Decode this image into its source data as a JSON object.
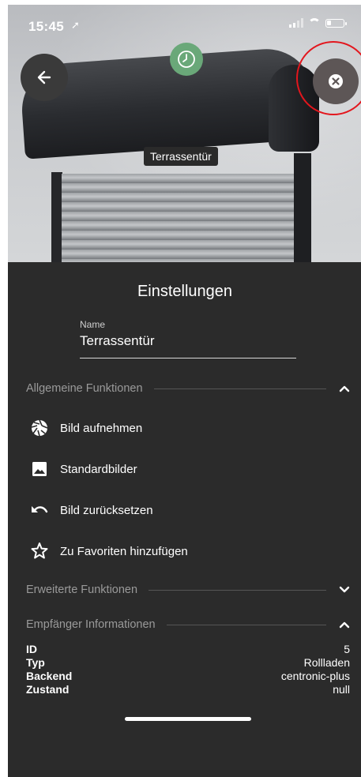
{
  "status_bar": {
    "time": "15:45"
  },
  "hero": {
    "device_label": "Terrassentür"
  },
  "settings": {
    "title": "Einstellungen",
    "name_label": "Name",
    "name_value": "Terrassentür"
  },
  "sections": {
    "general": {
      "label": "Allgemeine Funktionen",
      "expanded": true
    },
    "advanced": {
      "label": "Erweiterte Funktionen",
      "expanded": false
    },
    "receiver": {
      "label": "Empfänger Informationen",
      "expanded": true
    }
  },
  "general_items": [
    {
      "label": "Bild aufnehmen",
      "icon": "camera-shutter-icon"
    },
    {
      "label": "Standardbilder",
      "icon": "image-icon"
    },
    {
      "label": "Bild zurücksetzen",
      "icon": "undo-icon"
    },
    {
      "label": "Zu Favoriten hinzufügen",
      "icon": "star-outline-icon"
    }
  ],
  "receiver_info": [
    {
      "key": "ID",
      "value": "5"
    },
    {
      "key": "Typ",
      "value": "Rollladen"
    },
    {
      "key": "Backend",
      "value": "centronic-plus"
    },
    {
      "key": "Zustand",
      "value": "null"
    }
  ],
  "colors": {
    "sheet_bg": "#2b2b2b",
    "clock_button": "#6aa879",
    "highlight_ring": "#e3161d"
  }
}
